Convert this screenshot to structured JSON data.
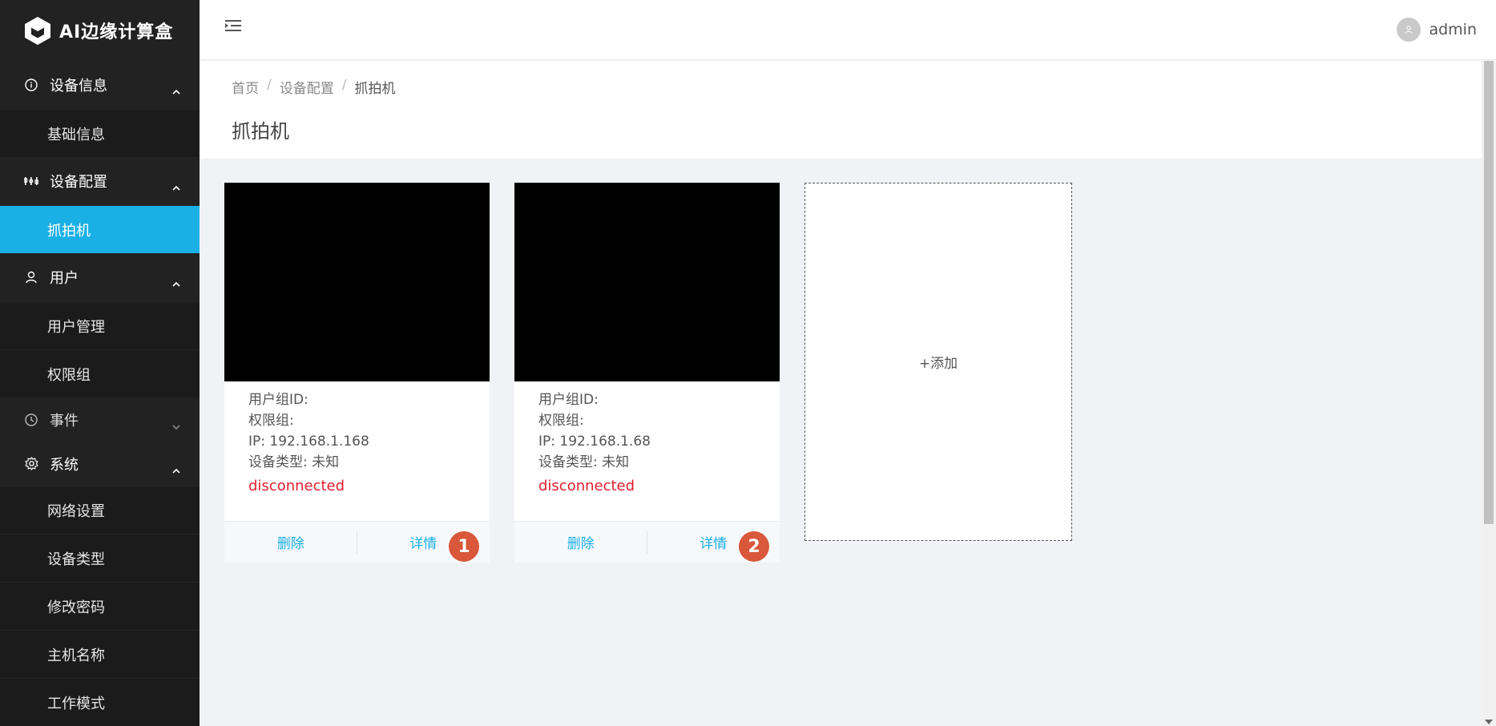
{
  "app": {
    "title": "AI边缘计算盒"
  },
  "header": {
    "username": "admin"
  },
  "sidebar": {
    "groups": [
      {
        "label": "设备信息",
        "icon": "info-icon",
        "expanded": true,
        "items": [
          {
            "label": "基础信息"
          }
        ]
      },
      {
        "label": "设备配置",
        "icon": "sliders-icon",
        "expanded": true,
        "items": [
          {
            "label": "抓拍机",
            "active": true
          }
        ]
      },
      {
        "label": "用户",
        "icon": "user-icon",
        "expanded": true,
        "items": [
          {
            "label": "用户管理"
          },
          {
            "label": "权限组"
          }
        ]
      },
      {
        "label": "事件",
        "icon": "clock-icon",
        "expanded": false,
        "items": []
      },
      {
        "label": "系统",
        "icon": "gear-icon",
        "expanded": true,
        "items": [
          {
            "label": "网络设置"
          },
          {
            "label": "设备类型"
          },
          {
            "label": "修改密码"
          },
          {
            "label": "主机名称"
          },
          {
            "label": "工作模式"
          }
        ]
      }
    ]
  },
  "breadcrumb": {
    "items": [
      "首页",
      "设备配置",
      "抓拍机"
    ],
    "separator": "/"
  },
  "page": {
    "title": "抓拍机"
  },
  "cards": [
    {
      "user_group": "用户组ID:",
      "permission_group": "权限组:",
      "ip": "IP: 192.168.1.168",
      "device_type": "设备类型: 未知",
      "status": "disconnected",
      "delete_label": "删除",
      "detail_label": "详情",
      "badge": "1"
    },
    {
      "user_group": "用户组ID:",
      "permission_group": "权限组:",
      "ip": "IP: 192.168.1.68",
      "device_type": "设备类型: 未知",
      "status": "disconnected",
      "delete_label": "删除",
      "detail_label": "详情",
      "badge": "2"
    }
  ],
  "add_card": {
    "label": "+添加"
  },
  "colors": {
    "accent": "#1ab0e6",
    "sidebar_bg": "#222222",
    "status_error": "#e0202e",
    "badge": "#d9573a"
  }
}
